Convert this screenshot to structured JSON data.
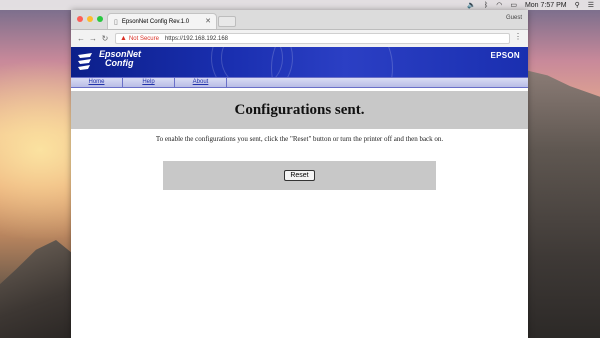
{
  "menubar": {
    "time": "Mon 7:57 PM"
  },
  "browser": {
    "tab_title": "EpsonNet Config Rev.1.0",
    "profile": "Guest",
    "security_label": "Not Secure",
    "url": "https://192.168.192.168"
  },
  "banner": {
    "logo_line1": "EpsonNet",
    "logo_line2": "Config",
    "brand": "EPSON"
  },
  "nav": {
    "home": "Home",
    "help": "Help",
    "about": "About"
  },
  "content": {
    "heading": "Configurations sent.",
    "message": "To enable the configurations you sent, click the \"Reset\" button or turn the printer off and then back on.",
    "reset_label": "Reset"
  },
  "colors": {
    "banner": "#1a2fb0",
    "warning": "#d93025",
    "panel_gray": "#c8c8c8"
  }
}
